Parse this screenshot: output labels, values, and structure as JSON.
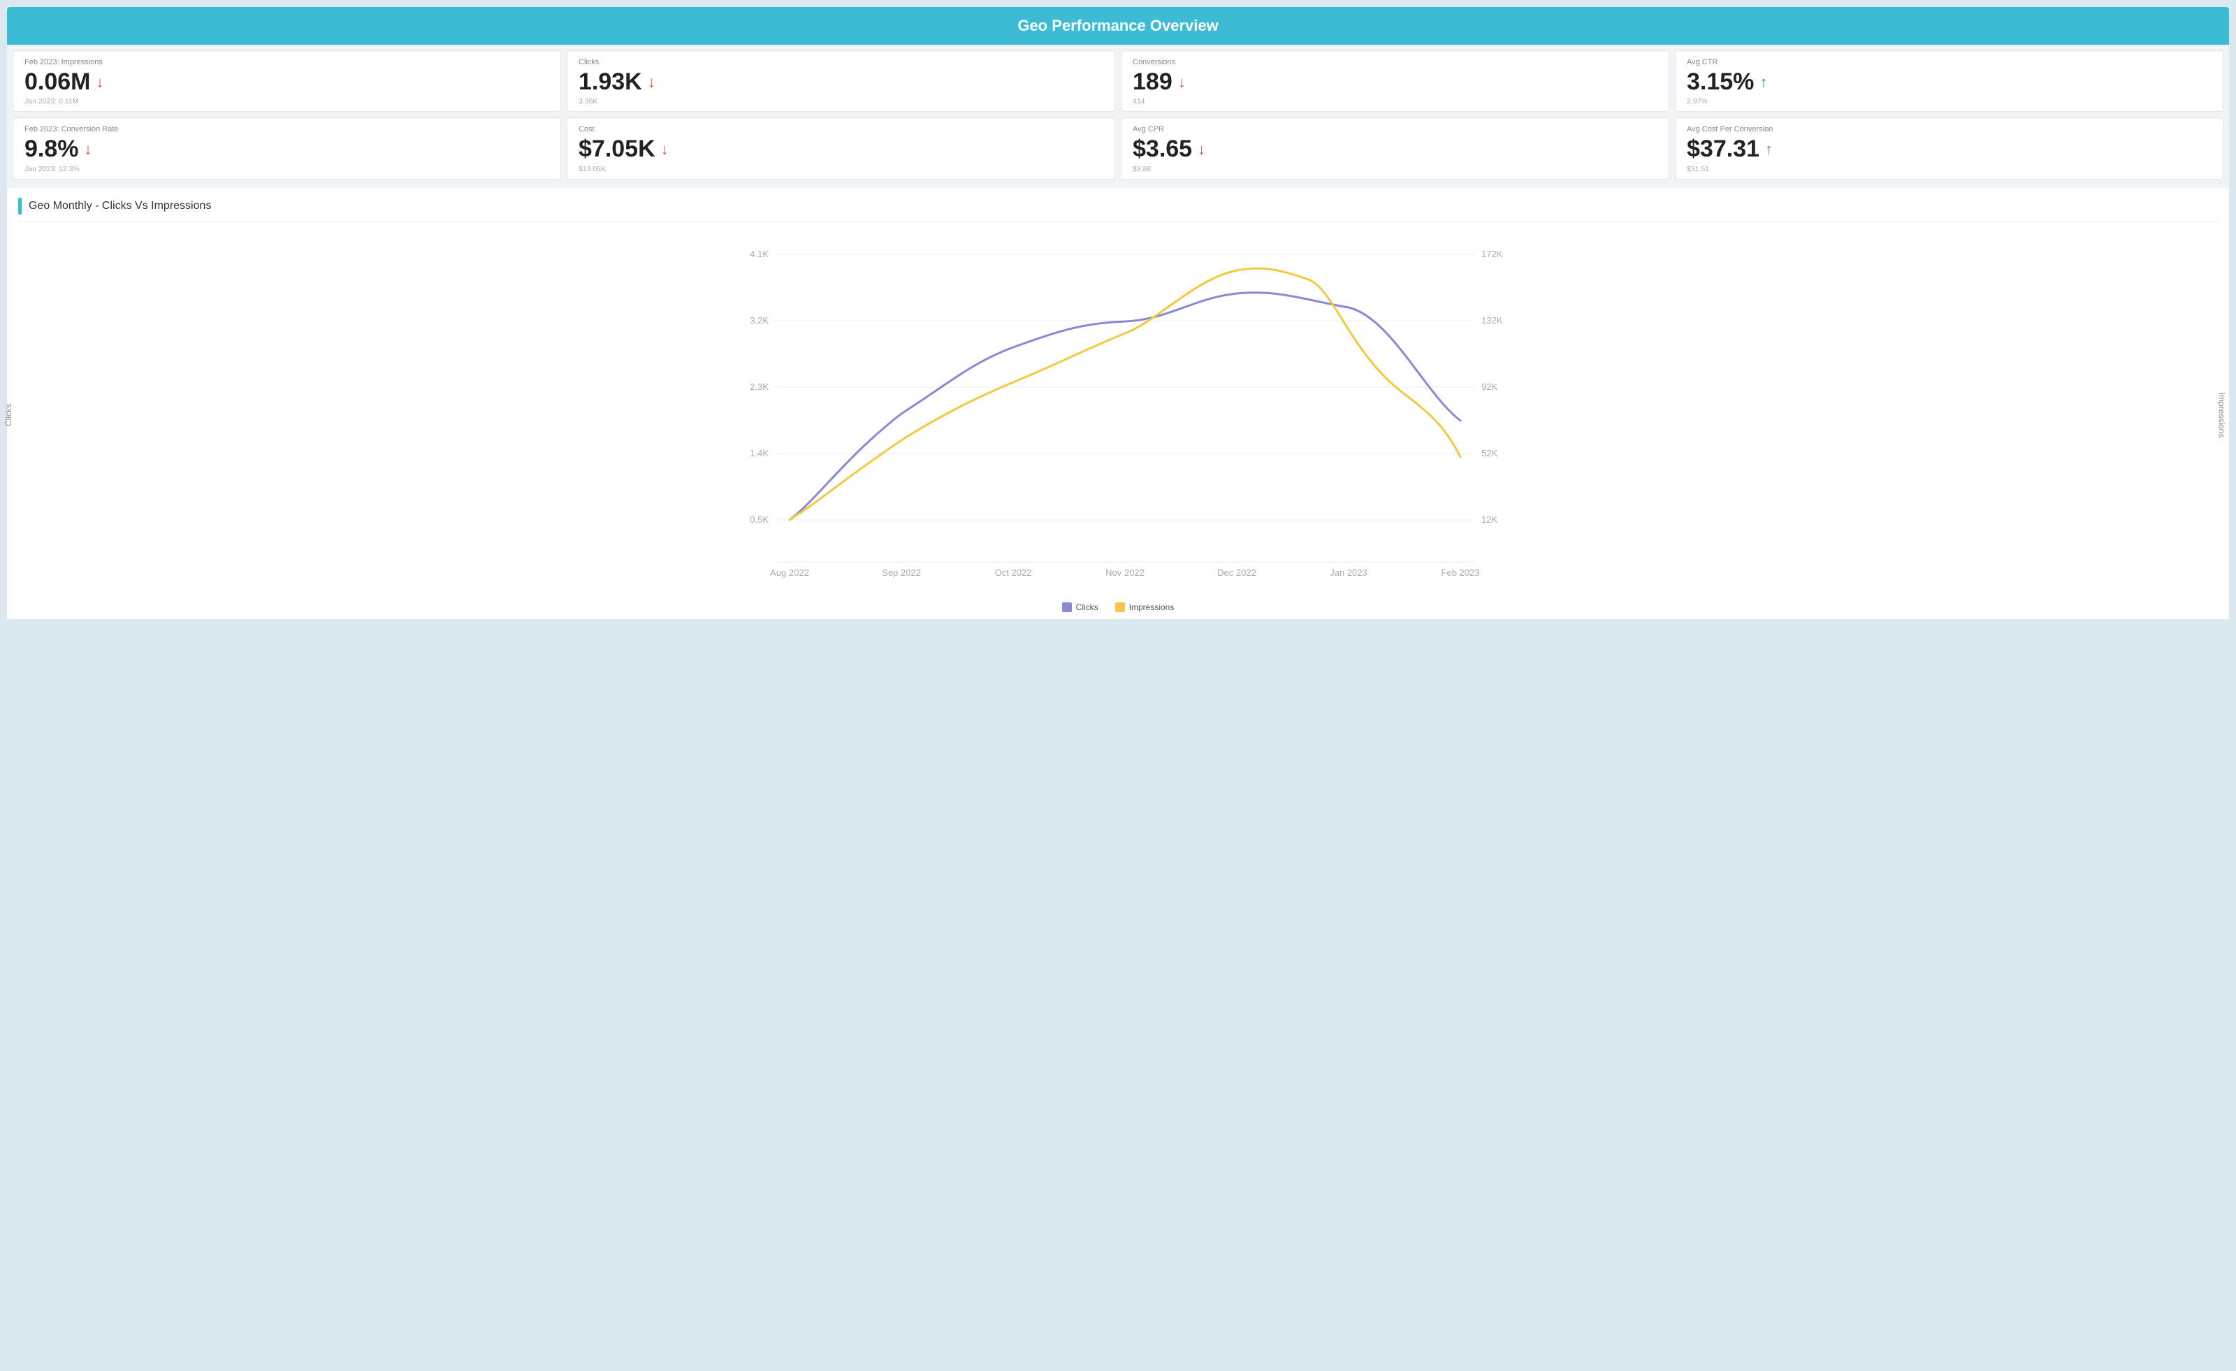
{
  "header": {
    "title": "Geo Performance Overview"
  },
  "metrics_row1": [
    {
      "label": "Feb 2023: Impressions",
      "value": "0.06M",
      "arrow": "down",
      "prev": "Jan 2023: 0.11M"
    },
    {
      "label": "Clicks",
      "value": "1.93K",
      "arrow": "down",
      "prev": "3.36K"
    },
    {
      "label": "Conversions",
      "value": "189",
      "arrow": "down",
      "prev": "414"
    },
    {
      "label": "Avg CTR",
      "value": "3.15%",
      "arrow": "up",
      "prev": "2.97%"
    }
  ],
  "metrics_row2": [
    {
      "label": "Feb 2023: Conversion Rate",
      "value": "9.8%",
      "arrow": "down",
      "prev": "Jan 2023: 12.3%"
    },
    {
      "label": "Cost",
      "value": "$7.05K",
      "arrow": "down",
      "prev": "$13.05K"
    },
    {
      "label": "Avg CPR",
      "value": "$3.65",
      "arrow": "down",
      "prev": "$3.88"
    },
    {
      "label": "Avg Cost Per Conversion",
      "value": "$37.31",
      "arrow": "up",
      "prev": "$31.51"
    }
  ],
  "chart": {
    "title": "Geo Monthly - Clicks Vs Impressions",
    "y_left_label": "Clicks",
    "y_right_label": "Impressions",
    "x_labels": [
      "Aug 2022",
      "Sep 2022",
      "Oct 2022",
      "Nov 2022",
      "Dec 2022",
      "Jan 2023",
      "Feb 2023"
    ],
    "y_left_ticks": [
      "0.5K",
      "1.4K",
      "2.3K",
      "3.2K",
      "4.1K"
    ],
    "y_right_ticks": [
      "12K",
      "52K",
      "92K",
      "132K",
      "172K"
    ],
    "legend": [
      {
        "label": "Clicks",
        "color": "#8b88d4"
      },
      {
        "label": "Impressions",
        "color": "#f5c842"
      }
    ]
  }
}
